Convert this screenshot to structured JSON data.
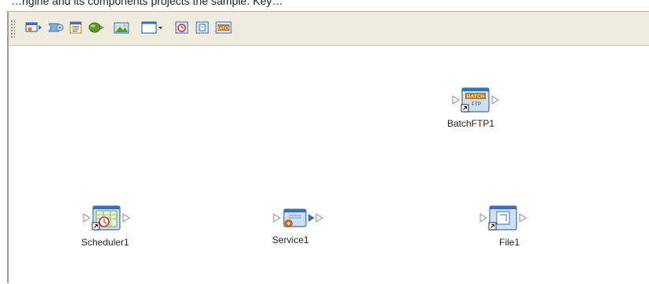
{
  "header": {
    "partial_caption": "…ngine and its components projects the sample. Key…"
  },
  "toolbar": {
    "buttons": [
      {
        "name": "add-input-icon"
      },
      {
        "name": "add-service-icon"
      },
      {
        "name": "add-form-icon"
      },
      {
        "name": "add-connector-icon"
      },
      {
        "name": "add-image-icon"
      },
      {
        "name": "add-window-dropdown-icon"
      },
      {
        "name": "add-scheduler-icon"
      },
      {
        "name": "add-file-icon"
      },
      {
        "name": "add-batch-icon",
        "text": "BATCH"
      }
    ]
  },
  "canvas": {
    "nodes": [
      {
        "id": "batchftp",
        "label": "BatchFTP1",
        "badge_top": "BATCH",
        "badge_bottom": "FTP"
      },
      {
        "id": "scheduler",
        "label": "Scheduler1"
      },
      {
        "id": "service",
        "label": "Service1"
      },
      {
        "id": "file",
        "label": "File1"
      }
    ]
  },
  "colors": {
    "toolbar_bg": "#efebdd",
    "icon_blue": "#3b6fb6",
    "icon_orange": "#e2711d",
    "icon_green": "#5a9a2a",
    "arrow_gray": "#8a8a8a"
  }
}
